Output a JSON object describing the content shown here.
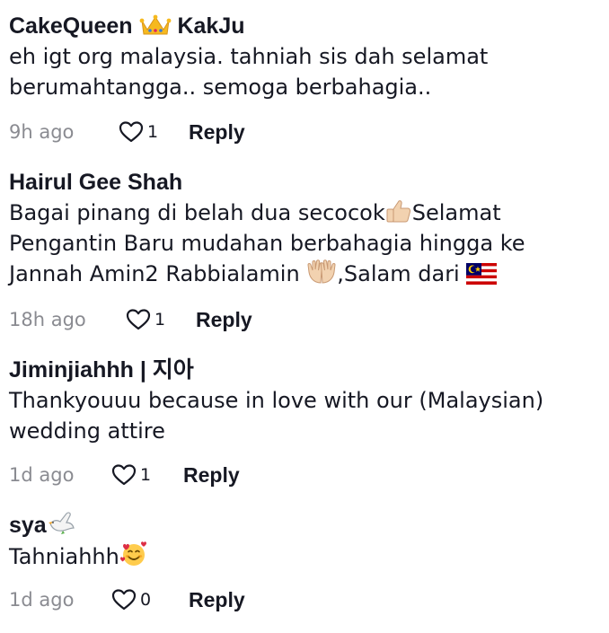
{
  "comments": [
    {
      "username_prefix": "CakeQueen",
      "username_suffix": "KakJu",
      "lines": [
        "eh igt org malaysia. tahniah sis dah selamat",
        "berumahtangga.. semoga berbahagia.."
      ],
      "time": "9h ago",
      "likes": "1",
      "reply": "Reply"
    },
    {
      "username": "Hairul Gee Shah",
      "line1_before": "Bagai pinang di belah dua secocok",
      "line1_after": "Selamat",
      "line2": "Pengantin Baru mudahan berbahagia hingga ke",
      "line3_before": "Jannah Amin2 Rabbialamin ",
      "line3_after": ",Salam dari ",
      "time": "18h ago",
      "likes": "1",
      "reply": "Reply"
    },
    {
      "username": "Jiminjiahhh | 지아",
      "lines": [
        "Thankyouuu because in love with our (Malaysian)",
        "wedding attire"
      ],
      "time": "1d ago",
      "likes": "1",
      "reply": "Reply"
    },
    {
      "username": "sya",
      "text": "Tahniahhh",
      "time": "1d ago",
      "likes": "0",
      "reply": "Reply"
    }
  ],
  "icons": {
    "like": "heart-outline-icon",
    "crown": "crown-emoji",
    "thumbs_up": "thumbs-up-emoji",
    "hands": "palms-up-emoji",
    "flag": "malaysia-flag-emoji",
    "dove": "dove-emoji",
    "smiling_hearts": "smiling-face-with-hearts-emoji"
  },
  "colors": {
    "text": "#161823",
    "meta": "#8a8b91",
    "background": "#ffffff"
  }
}
